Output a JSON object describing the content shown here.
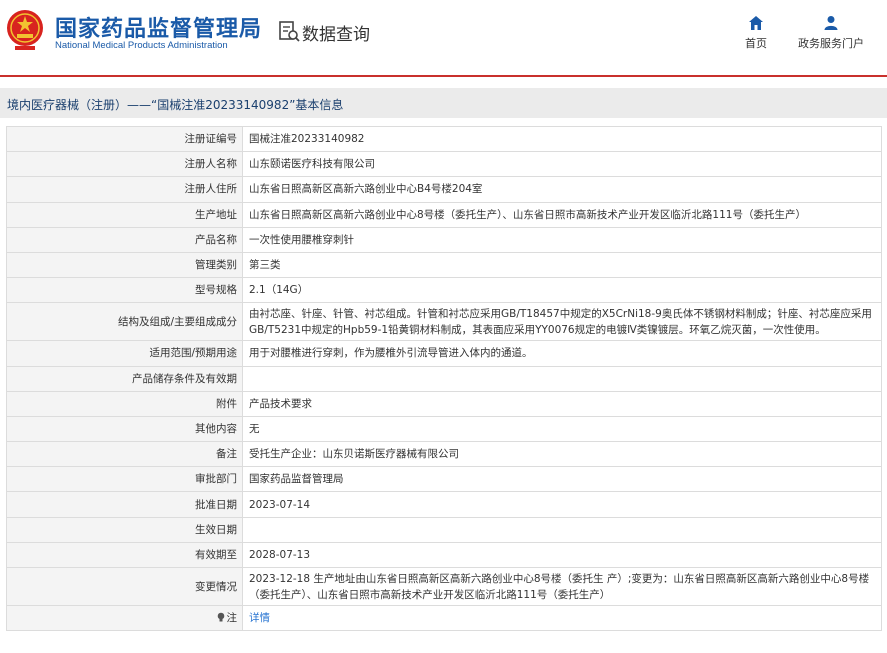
{
  "header": {
    "title_cn": "国家药品监督管理局",
    "title_en": "National Medical Products Administration",
    "query_title": "数据查询",
    "nav": [
      {
        "label": "首页",
        "icon": "home-icon"
      },
      {
        "label": "政务服务门户",
        "icon": "person-icon"
      }
    ]
  },
  "breadcrumb": "境内医疗器械（注册）——“国械注准20233140982”基本信息",
  "rows": [
    {
      "label": "注册证编号",
      "value": "国械注准20233140982"
    },
    {
      "label": "注册人名称",
      "value": "山东颐诺医疗科技有限公司"
    },
    {
      "label": "注册人住所",
      "value": "山东省日照高新区高新六路创业中心B4号楼204室"
    },
    {
      "label": "生产地址",
      "value": "山东省日照高新区高新六路创业中心8号楼（委托生产）、山东省日照市高新技术产业开发区临沂北路111号（委托生产）"
    },
    {
      "label": "产品名称",
      "value": "一次性使用腰椎穿刺针"
    },
    {
      "label": "管理类别",
      "value": "第三类"
    },
    {
      "label": "型号规格",
      "value": "2.1（14G）"
    },
    {
      "label": "结构及组成/主要组成成分",
      "value": "由衬芯座、针座、针管、衬芯组成。针管和衬芯应采用GB/T18457中规定的X5CrNi18-9奥氏体不锈钢材料制成；针座、衬芯座应采用GB/T5231中规定的Hpb59-1铅黄铜材料制成，其表面应采用YY0076规定的电镀Ⅳ类镍镀层。环氧乙烷灭菌，一次性使用。"
    },
    {
      "label": "适用范围/预期用途",
      "value": "用于对腰椎进行穿刺，作为腰椎外引流导管进入体内的通道。"
    },
    {
      "label": "产品储存条件及有效期",
      "value": ""
    },
    {
      "label": "附件",
      "value": "产品技术要求"
    },
    {
      "label": "其他内容",
      "value": "无"
    },
    {
      "label": "备注",
      "value": "受托生产企业：山东贝诺斯医疗器械有限公司"
    },
    {
      "label": "审批部门",
      "value": "国家药品监督管理局"
    },
    {
      "label": "批准日期",
      "value": "2023-07-14"
    },
    {
      "label": "生效日期",
      "value": ""
    },
    {
      "label": "有效期至",
      "value": "2028-07-13"
    },
    {
      "label": "变更情况",
      "value": "2023-12-18 生产地址由山东省日照高新区高新六路创业中心8号楼（委托生 产）;变更为：山东省日照高新区高新六路创业中心8号楼（委托生产）、山东省日照市高新技术产业开发区临沂北路111号（委托生产）"
    },
    {
      "label": "注",
      "value": "详情",
      "icon": "bulb-icon"
    }
  ],
  "colors": {
    "brand": "#1a5aa8",
    "accent_red": "#c9302c",
    "link": "#2874d1"
  }
}
